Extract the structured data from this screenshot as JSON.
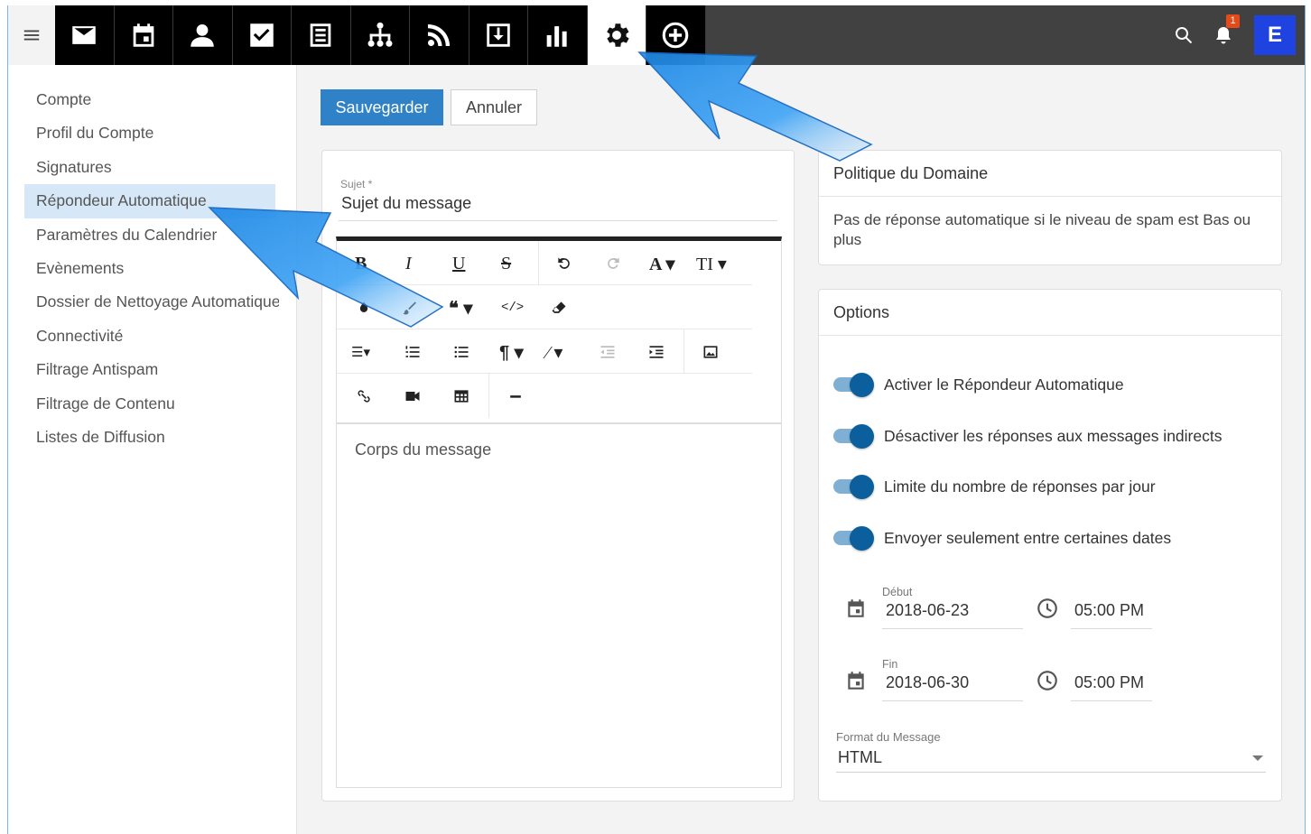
{
  "topbar": {
    "nav_tabs": [
      {
        "icon": "mail-icon",
        "active": false
      },
      {
        "icon": "calendar-icon",
        "active": false
      },
      {
        "icon": "contacts-icon",
        "active": false
      },
      {
        "icon": "tasks-icon",
        "active": false
      },
      {
        "icon": "notes-icon",
        "active": false
      },
      {
        "icon": "sitemap-icon",
        "active": false
      },
      {
        "icon": "rss-icon",
        "active": false
      },
      {
        "icon": "archive-icon",
        "active": false
      },
      {
        "icon": "stats-icon",
        "active": false
      },
      {
        "icon": "settings-icon",
        "active": true
      },
      {
        "icon": "add-circle-icon",
        "active": false
      }
    ],
    "notification_count": "1",
    "avatar_letter": "E",
    "avatar_color": "#1f43e0"
  },
  "sidebar": {
    "items": [
      {
        "label": "Compte"
      },
      {
        "label": "Profil du Compte"
      },
      {
        "label": "Signatures"
      },
      {
        "label": "Répondeur Automatique",
        "active": true
      },
      {
        "label": "Paramètres du Calendrier"
      },
      {
        "label": "Evènements"
      },
      {
        "label": "Dossier de Nettoyage Automatique"
      },
      {
        "label": "Connectivité"
      },
      {
        "label": "Filtrage Antispam"
      },
      {
        "label": "Filtrage de Contenu"
      },
      {
        "label": "Listes de Diffusion"
      }
    ]
  },
  "actions": {
    "save_label": "Sauvegarder",
    "cancel_label": "Annuler"
  },
  "editor": {
    "subject_label": "Sujet *",
    "subject_value": "Sujet du message",
    "body_placeholder": "Corps du message"
  },
  "policy": {
    "title": "Politique du Domaine",
    "text": "Pas de réponse automatique si le niveau de spam est Bas ou plus"
  },
  "options": {
    "title": "Options",
    "toggles": [
      {
        "label": "Activer le Répondeur Automatique",
        "on": true
      },
      {
        "label": "Désactiver les réponses aux messages indirects",
        "on": true
      },
      {
        "label": "Limite du nombre de réponses par jour",
        "on": true
      },
      {
        "label": "Envoyer seulement entre certaines dates",
        "on": true
      }
    ],
    "start": {
      "label": "Début",
      "date": "2018-06-23",
      "time": "05:00 PM"
    },
    "end": {
      "label": "Fin",
      "date": "2018-06-30",
      "time": "05:00 PM"
    },
    "format_label": "Format du Message",
    "format_value": "HTML"
  },
  "colors": {
    "primary": "#2f82c7",
    "toggle_knob": "#0a5f9c",
    "topbar": "#414141",
    "sidebar_active": "#d6e8f7",
    "badge": "#e64a19"
  }
}
